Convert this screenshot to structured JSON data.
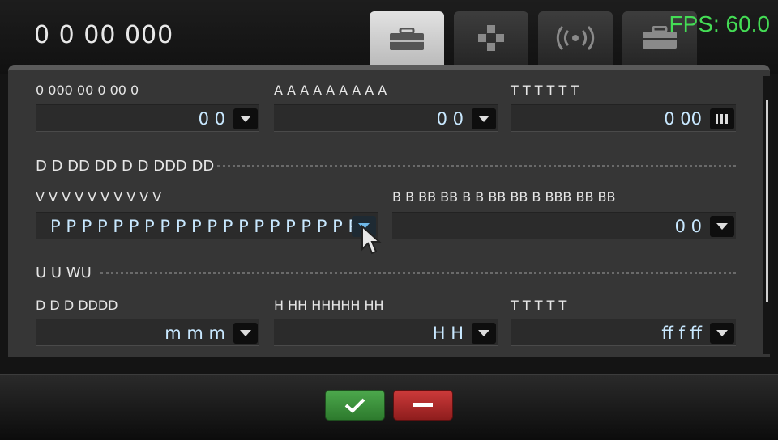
{
  "header": {
    "title": "0 0 00 000",
    "fps": "FPS: 60.0"
  },
  "tabs": [
    {
      "name": "toolbox",
      "icon": "toolbox-icon",
      "active": true
    },
    {
      "name": "gamepad",
      "icon": "gamepad-icon",
      "active": false
    },
    {
      "name": "wireless",
      "icon": "wireless-icon",
      "active": false
    },
    {
      "name": "toolbox-2",
      "icon": "toolbox-icon",
      "active": false
    }
  ],
  "rows": {
    "row1": [
      {
        "label": "0 000 00 0 00 0",
        "value": "0 0",
        "button_icon": "dropdown-arrow-icon"
      },
      {
        "label": "A A A A A A A A A",
        "value": "0 0",
        "button_icon": "dropdown-arrow-icon"
      },
      {
        "label": "T T T T T T",
        "value": "0 00",
        "button_icon": "keypad-icon"
      }
    ],
    "section1": "D D DD DD D D DDD DD",
    "row2": [
      {
        "label": "V V V V V V V V V V",
        "value": "P P P P  P P P P P P P P P  P P P P P P P",
        "button_icon": "dropdown-arrow-icon"
      },
      {
        "label": "B B BB BB  B  B BB BB  B BBB BB BB",
        "value": "0 0",
        "button_icon": "dropdown-arrow-icon"
      }
    ],
    "section2": "U U WU",
    "row3": [
      {
        "label": "D D D DDDD",
        "value": "m m m",
        "button_icon": "dropdown-arrow-icon"
      },
      {
        "label": "H HH HHHHH HH",
        "value": "H H",
        "button_icon": "dropdown-arrow-icon"
      },
      {
        "label": "T T T T T",
        "value": "ff f ff",
        "button_icon": "dropdown-arrow-icon"
      }
    ]
  },
  "actions": {
    "ok_icon": "checkmark-icon",
    "cancel_icon": "minus-icon"
  },
  "colors": {
    "fps": "#44dd55",
    "ok": "#3c9a3c",
    "cancel": "#b52a2a",
    "value_text": "#c8e8ff"
  }
}
